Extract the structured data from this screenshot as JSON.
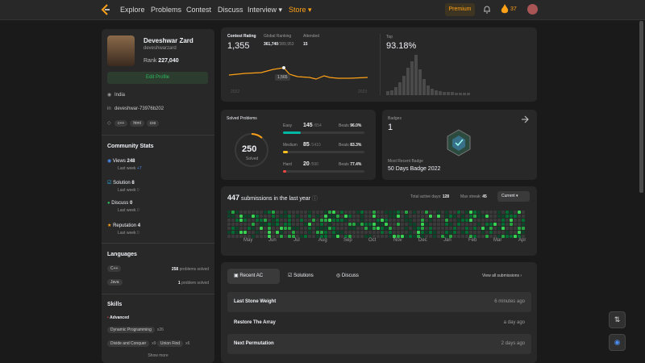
{
  "nav": {
    "items": [
      "Explore",
      "Problems",
      "Contest",
      "Discuss",
      "Interview ▾",
      "Store ▾"
    ],
    "premium": "Premium",
    "streak": "37"
  },
  "profile": {
    "name": "Deveshwar Zard",
    "handle": "deveshwarzard",
    "rank_label": "Rank",
    "rank": "227,040",
    "edit": "Edit Profile",
    "location": "India",
    "linkedin": "deveshwar-73976b202",
    "tags": [
      "c++",
      "html",
      "css"
    ]
  },
  "community": {
    "title": "Community Stats",
    "items": [
      {
        "label": "Views",
        "value": "248",
        "last_week_label": "Last week",
        "last_week": "+7",
        "color": "#4a8cf0",
        "icon": "eye-icon"
      },
      {
        "label": "Solution",
        "value": "8",
        "last_week_label": "Last week",
        "last_week": "0",
        "color": "#2db7f5",
        "icon": "check-icon"
      },
      {
        "label": "Discuss",
        "value": "0",
        "last_week_label": "Last week",
        "last_week": "0",
        "color": "#2cbb5d",
        "icon": "chat-icon"
      },
      {
        "label": "Reputation",
        "value": "4",
        "last_week_label": "Last week",
        "last_week": "0",
        "color": "#ffa116",
        "icon": "star-icon"
      }
    ]
  },
  "languages": {
    "title": "Languages",
    "items": [
      {
        "name": "C++",
        "count": "258",
        "unit": "problems solved"
      },
      {
        "name": "Java",
        "count": "1",
        "unit": "problem solved"
      }
    ]
  },
  "skills": {
    "title": "Skills",
    "level": "Advanced",
    "items": [
      {
        "name": "Dynamic Programming",
        "count": "x26"
      },
      {
        "name": "Divide and Conquer",
        "count": "x9"
      },
      {
        "name": "Union Find",
        "count": "x6"
      }
    ],
    "more": "Show more"
  },
  "contest": {
    "rating_label": "Contest Rating",
    "rating": "1,355",
    "ranking_label": "Global Ranking",
    "ranking": "361,740",
    "ranking_total": "/389,953",
    "attended_label": "Attended",
    "attended": "15",
    "tooltip": "1,565",
    "year_start": "2022",
    "year_end": "2023",
    "top_label": "Top",
    "top": "93.18%"
  },
  "solved": {
    "title": "Solved Problems",
    "total": "250",
    "total_label": "Solved",
    "beats_label": "Beats",
    "rows": [
      {
        "name": "Easy",
        "count": "145",
        "total": "/654",
        "beats": "96.0%",
        "fill": 0.22,
        "color": "#00b8a3"
      },
      {
        "name": "Medium",
        "count": "85",
        "total": "/1410",
        "beats": "83.3%",
        "fill": 0.06,
        "color": "#ffc01e"
      },
      {
        "name": "Hard",
        "count": "20",
        "total": "/590",
        "beats": "77.4%",
        "fill": 0.034,
        "color": "#ef4743"
      }
    ]
  },
  "badges": {
    "title": "Badges",
    "count": "1",
    "recent_label": "Most Recent Badge",
    "recent": "50 Days Badge 2022"
  },
  "submissions": {
    "count": "447",
    "text": "submissions in the last year",
    "active_label": "Total active days:",
    "active": "128",
    "streak_label": "Max streak:",
    "streak": "45",
    "select": "Current ▾",
    "months": [
      "May",
      "Jun",
      "Jul",
      "Aug",
      "Sep",
      "Oct",
      "Nov",
      "Dec",
      "Jan",
      "Feb",
      "Mar",
      "Apr"
    ]
  },
  "recent": {
    "tabs": [
      "Recent AC",
      "Solutions",
      "Discuss"
    ],
    "view_all": "View all submissions  ›",
    "items": [
      {
        "name": "Last Stone Weight",
        "time": "6 minutes ago"
      },
      {
        "name": "Restore The Array",
        "time": "a day ago"
      },
      {
        "name": "Next Permutation",
        "time": "2 days ago"
      }
    ]
  }
}
